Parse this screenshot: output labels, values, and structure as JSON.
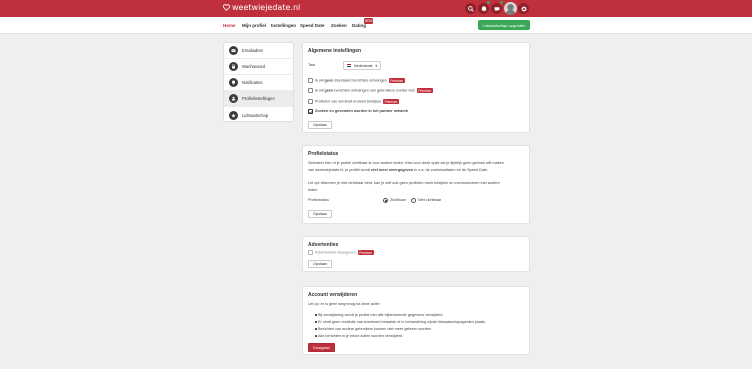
{
  "header": {
    "logo_text": "weetwiejedate.nl",
    "brand_color": "#c0303c",
    "icons": [
      "search-icon",
      "bell-icon",
      "chat-icon",
      "star-icon",
      "settings-icon"
    ]
  },
  "nav": {
    "items": [
      "Home",
      "Mijn profiel",
      "Instellingen",
      "Speed Date",
      "Zoeken",
      "Dating"
    ],
    "dating_badge": "NEW",
    "upgrade_label": "Lidmaatschap upgraden",
    "upgrade_color": "#3aa757"
  },
  "sidebar": {
    "items": [
      {
        "label": "Emailadres",
        "icon": "envelope-icon"
      },
      {
        "label": "Wachtwoord",
        "icon": "lock-icon"
      },
      {
        "label": "Notificaties",
        "icon": "bell-icon"
      },
      {
        "label": "Profielinstellingen",
        "icon": "user-icon"
      },
      {
        "label": "Lidmaatschap",
        "icon": "star-icon"
      }
    ]
  },
  "general": {
    "title": "Algemene instellingen",
    "language_label": "Taal",
    "language_value": "Nederlands",
    "options": [
      {
        "pre": "Ik wil ",
        "bold": "geen",
        "post": " standaard berichten ontvangen",
        "premium": true,
        "checked": false
      },
      {
        "pre": "Ik wil ",
        "bold": "geen",
        "post": " berichten ontvangen van gebruikers zonder foto",
        "premium": true,
        "checked": false
      },
      {
        "pre": "Profielen van verderaf ervaren bekijken",
        "bold": "",
        "post": "",
        "premium": true,
        "checked": false
      },
      {
        "pre": "",
        "bold": "Zoeken en gevonden worden in het partner netwerk",
        "post": "",
        "premium": false,
        "checked": true
      }
    ],
    "premium_label": "Premium",
    "save_label": "Opslaan"
  },
  "profile_status": {
    "title": "Profielstatus",
    "text1": "Selecteer hier of je profiel zichtbaar is voor andere leden. Kies voor deze optie als je tijdelijk geen gebruik wilt maken",
    "text2_pre": "van weetwiejedate.nl, je profiel wordt ",
    "text2_bold": "niet meer weergegeven",
    "text2_post": " in o.a. de zoekresultaten en de Speed Date.",
    "text3": "Let op! Wanneer je niet zichtbaar bent, kan je zelf ook geen profielen meer bekijken en communiceren met andere",
    "text4": "leden.",
    "status_label": "Profielstatus",
    "visible_label": "Zichtbaar",
    "hidden_label": "Niet zichtbaar",
    "save_label": "Opslaan"
  },
  "ads": {
    "title": "Advertenties",
    "option_label": "Advertenties weergeven",
    "premium_label": "Premium",
    "save_label": "Opslaan"
  },
  "delete": {
    "title": "Account verwijderen",
    "warning": "Let op: er is geen weg terug na deze actie!",
    "bullets": [
      "Bij verwijdering wordt je profiel met alle bijbehorende gegevens verwijderd",
      "Er vindt geen restitutie van eventueel betaalde of in behandeling zijnde lidmaatschapsgelden plaats",
      "Berichten van andere gebruikers kunnen niet meer gelezen worden",
      "Alle berichten in je Inbox zullen worden verwijderd"
    ],
    "delete_label": "Doorgaan"
  }
}
